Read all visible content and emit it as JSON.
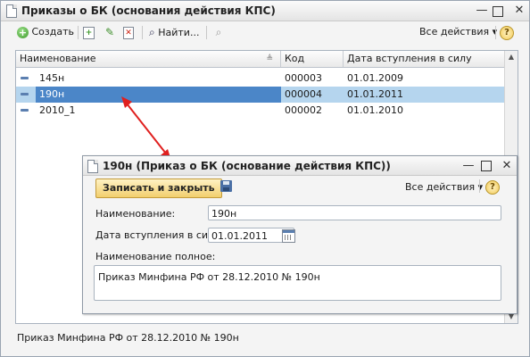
{
  "main": {
    "title": "Приказы о БК (основания действия КПС)",
    "toolbar": {
      "create_label": "Создать",
      "find_label": "Найти...",
      "all_actions_label": "Все действия ▾",
      "help_label": "?"
    },
    "columns": [
      "Наименование",
      "Код",
      "Дата вступления в силу"
    ],
    "rows": [
      {
        "name": "145н",
        "code": "000003",
        "date": "01.01.2009"
      },
      {
        "name": "190н",
        "code": "000004",
        "date": "01.01.2011"
      },
      {
        "name": "2010_1",
        "code": "000002",
        "date": "01.01.2010"
      }
    ],
    "selected_row_index": 1,
    "status_text": "Приказ Минфина РФ от 28.12.2010 № 190н"
  },
  "dialog": {
    "title": "190н (Приказ о БК (основание действия КПС))",
    "save_close_label": "Записать и закрыть",
    "all_actions_label": "Все действия ▾",
    "help_label": "?",
    "name_label": "Наименование:",
    "name_value": "190н",
    "date_label": "Дата вступления в силу:",
    "date_value": "01.01.2011",
    "full_name_label": "Наименование полное:",
    "full_name_value": "Приказ Минфина РФ от 28.12.2010 № 190н"
  },
  "colors": {
    "selection": "#b5d5ee",
    "arrow": "#e0201f",
    "primary_button": "#f2cf6e"
  }
}
